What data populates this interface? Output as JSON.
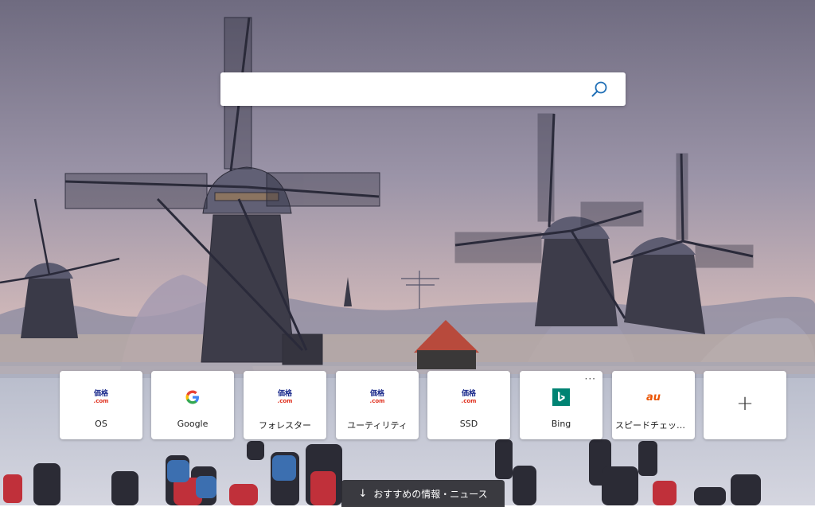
{
  "search": {
    "value": "",
    "placeholder": "",
    "icon": "search-icon"
  },
  "tiles": [
    {
      "label": "OS",
      "logo": "kakaku-com",
      "logo_line1": "価格",
      "logo_line2": ".com"
    },
    {
      "label": "Google",
      "logo": "google-g",
      "logo_text": "G"
    },
    {
      "label": "フォレスター",
      "logo": "kakaku-com",
      "logo_line1": "価格",
      "logo_line2": ".com"
    },
    {
      "label": "ユーティリティ",
      "logo": "kakaku-com",
      "logo_line1": "価格",
      "logo_line2": ".com"
    },
    {
      "label": "SSD",
      "logo": "kakaku-com",
      "logo_line1": "価格",
      "logo_line2": ".com"
    },
    {
      "label": "Bing",
      "logo": "bing-b",
      "menu": "···"
    },
    {
      "label": "スピードチェック | ...",
      "logo": "au",
      "logo_text": "au"
    },
    {
      "label": "",
      "logo": "plus-icon",
      "logo_text": "+"
    }
  ],
  "news_button": {
    "arrow": "↓",
    "label": "おすすめの情報・ニュース"
  },
  "colors": {
    "kakaku_blue": "#1a2a8c",
    "kakaku_red": "#e0301e",
    "bing_teal": "#008373",
    "au_orange": "#eb5505",
    "search_icon": "#1f6fb6"
  }
}
